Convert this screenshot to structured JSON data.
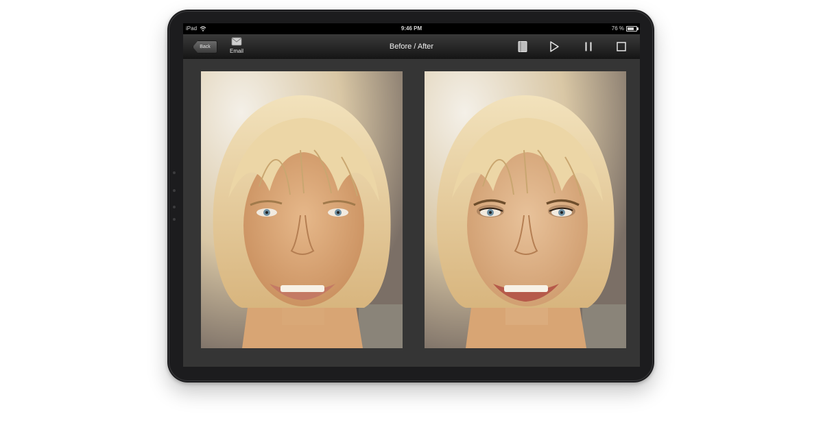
{
  "status_bar": {
    "device": "iPad",
    "time": "9:46 PM",
    "battery": "76 %",
    "battery_level": 0.76
  },
  "toolbar": {
    "back_label": "Back",
    "email_label": "Email",
    "title": "Before / After",
    "icons": [
      "book-icon",
      "play-icon",
      "pause-icon",
      "stop-icon"
    ]
  },
  "photos": {
    "left": "before-photo",
    "right": "after-photo"
  },
  "colors": {
    "device_bezel": "#1c1c1e",
    "screen_background": "#353535",
    "toolbar_top": "#3a3a3a",
    "toolbar_bottom": "#151515"
  }
}
